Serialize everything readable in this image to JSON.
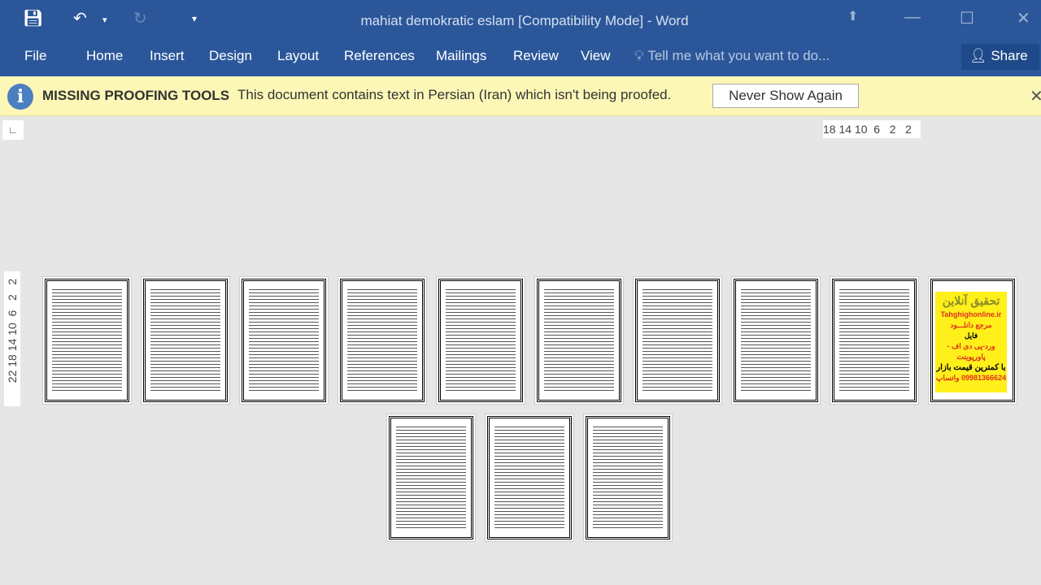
{
  "titlebar": {
    "title": "mahiat demokratic eslam [Compatibility Mode] - Word",
    "save_icon": "save-icon",
    "undo_icon": "undo-icon",
    "redo_icon": "redo-icon"
  },
  "tabs": [
    "File",
    "Home",
    "Insert",
    "Design",
    "Layout",
    "References",
    "Mailings",
    "Review",
    "View"
  ],
  "tell_me": "Tell me what you want to do...",
  "share": "Share",
  "message": {
    "title": "MISSING PROOFING TOOLS",
    "text": "This document contains text in Persian (Iran) which isn't being proofed.",
    "button": "Never Show Again"
  },
  "ruler": {
    "horizontal": "18 14 10  6   2   2",
    "vertical": "22 18 14 10  6   2   2"
  },
  "ad": {
    "title": "تحقیق آنلاین",
    "site": "Tahghighonline.ir",
    "line1": "مرجع دانلـــود",
    "line2": "فایل",
    "line3": "ورد-پی دی اف - پاورپوینت",
    "line4": "با کمترین قیمت بازار",
    "line5": "09981366624 واتساپ"
  },
  "colors": {
    "ribbon": "#2b579a",
    "message_bar": "#fcf7b6",
    "ad_background": "#ffef1a"
  }
}
